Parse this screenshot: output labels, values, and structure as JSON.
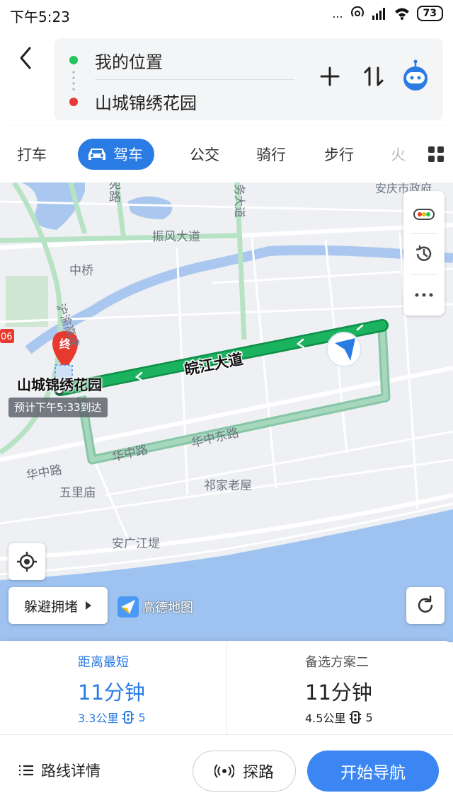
{
  "status_bar": {
    "time": "下午5:23",
    "dots": "...",
    "battery": "73"
  },
  "header": {
    "origin": "我的位置",
    "destination": "山城锦绣花园"
  },
  "tabs": [
    {
      "label": "打车"
    },
    {
      "label": "驾车",
      "active": true
    },
    {
      "label": "公交"
    },
    {
      "label": "骑行"
    },
    {
      "label": "步行"
    },
    {
      "label": "火"
    }
  ],
  "map": {
    "labels": {
      "l1": "安庆市政府",
      "l2": "振风大道",
      "l3": "中桥",
      "l4": "沪渝高速",
      "l5": "皖江大道",
      "l6": "华中东路",
      "l7": "华中路",
      "l8": "华中路",
      "l9": "五里庙",
      "l10": "祁家老屋",
      "l11": "安广江堤",
      "l12": "路",
      "l13": "务大道",
      "l14": "06",
      "l15": "苑"
    },
    "end_marker": "终",
    "destination_label": "山城锦绣花园",
    "eta": "预计下午5:33到达",
    "avoid_label": "躲避拥堵",
    "logo_text": "高德地图"
  },
  "plans": [
    {
      "title": "距离最短",
      "time": "11分钟",
      "distance": "3.3公里",
      "lights": "5"
    },
    {
      "title": "备选方案二",
      "time": "11分钟",
      "distance": "4.5公里",
      "lights": "5"
    }
  ],
  "bottom": {
    "detail_label": "路线详情",
    "probe_label": "探路",
    "start_label": "开始导航"
  },
  "colors": {
    "accent": "#2a7be4",
    "route_main": "#16a65a",
    "route_alt": "#8cc8ac",
    "river": "#aac8ef"
  }
}
